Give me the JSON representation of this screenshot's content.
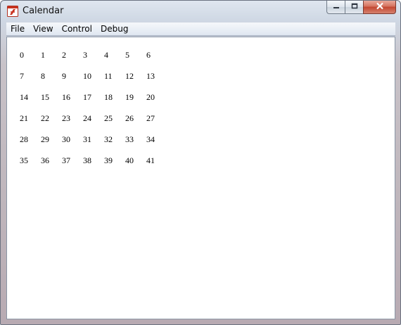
{
  "window": {
    "title": "Calendar",
    "icon": "flash-app-icon",
    "buttons": [
      "minimize-icon",
      "maximize-icon",
      "close-icon"
    ]
  },
  "menu": [
    "File",
    "View",
    "Control",
    "Debug"
  ],
  "grid": {
    "rows": [
      [
        "0",
        "1",
        "2",
        "3",
        "4",
        "5",
        "6"
      ],
      [
        "7",
        "8",
        "9",
        "10",
        "11",
        "12",
        "13"
      ],
      [
        "14",
        "15",
        "16",
        "17",
        "18",
        "19",
        "20"
      ],
      [
        "21",
        "22",
        "23",
        "24",
        "25",
        "26",
        "27"
      ],
      [
        "28",
        "29",
        "30",
        "31",
        "32",
        "33",
        "34"
      ],
      [
        "35",
        "36",
        "37",
        "38",
        "39",
        "40",
        "41"
      ]
    ]
  }
}
